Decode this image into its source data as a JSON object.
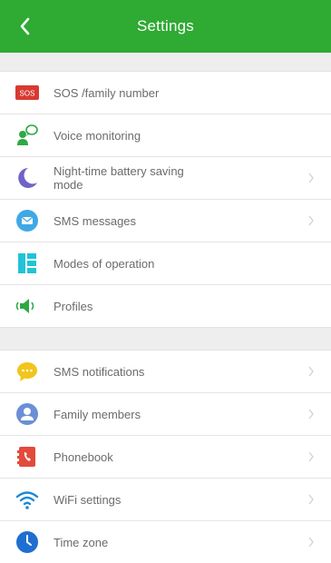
{
  "header": {
    "title": "Settings",
    "back_icon": "chevron-left-icon"
  },
  "colors": {
    "header_bg": "#2faa33",
    "text": "#6b6b6b",
    "band": "#eeeeee"
  },
  "section1": [
    {
      "label": "SOS /family number",
      "icon": "sos-icon",
      "chevron": false
    },
    {
      "label": "Voice monitoring",
      "icon": "voice-monitor-icon",
      "chevron": false
    },
    {
      "label": "Night-time battery saving mode",
      "icon": "moon-icon",
      "chevron": true
    },
    {
      "label": "SMS messages",
      "icon": "message-icon",
      "chevron": true
    },
    {
      "label": "Modes of operation",
      "icon": "modes-icon",
      "chevron": false
    },
    {
      "label": "Profiles",
      "icon": "speaker-icon",
      "chevron": false
    }
  ],
  "section2": [
    {
      "label": "SMS notifications",
      "icon": "chat-bubble-icon",
      "chevron": true
    },
    {
      "label": "Family members",
      "icon": "person-icon",
      "chevron": true
    },
    {
      "label": "Phonebook",
      "icon": "phonebook-icon",
      "chevron": true
    },
    {
      "label": "WiFi settings",
      "icon": "wifi-icon",
      "chevron": true
    },
    {
      "label": "Time zone",
      "icon": "clock-icon",
      "chevron": true
    }
  ]
}
